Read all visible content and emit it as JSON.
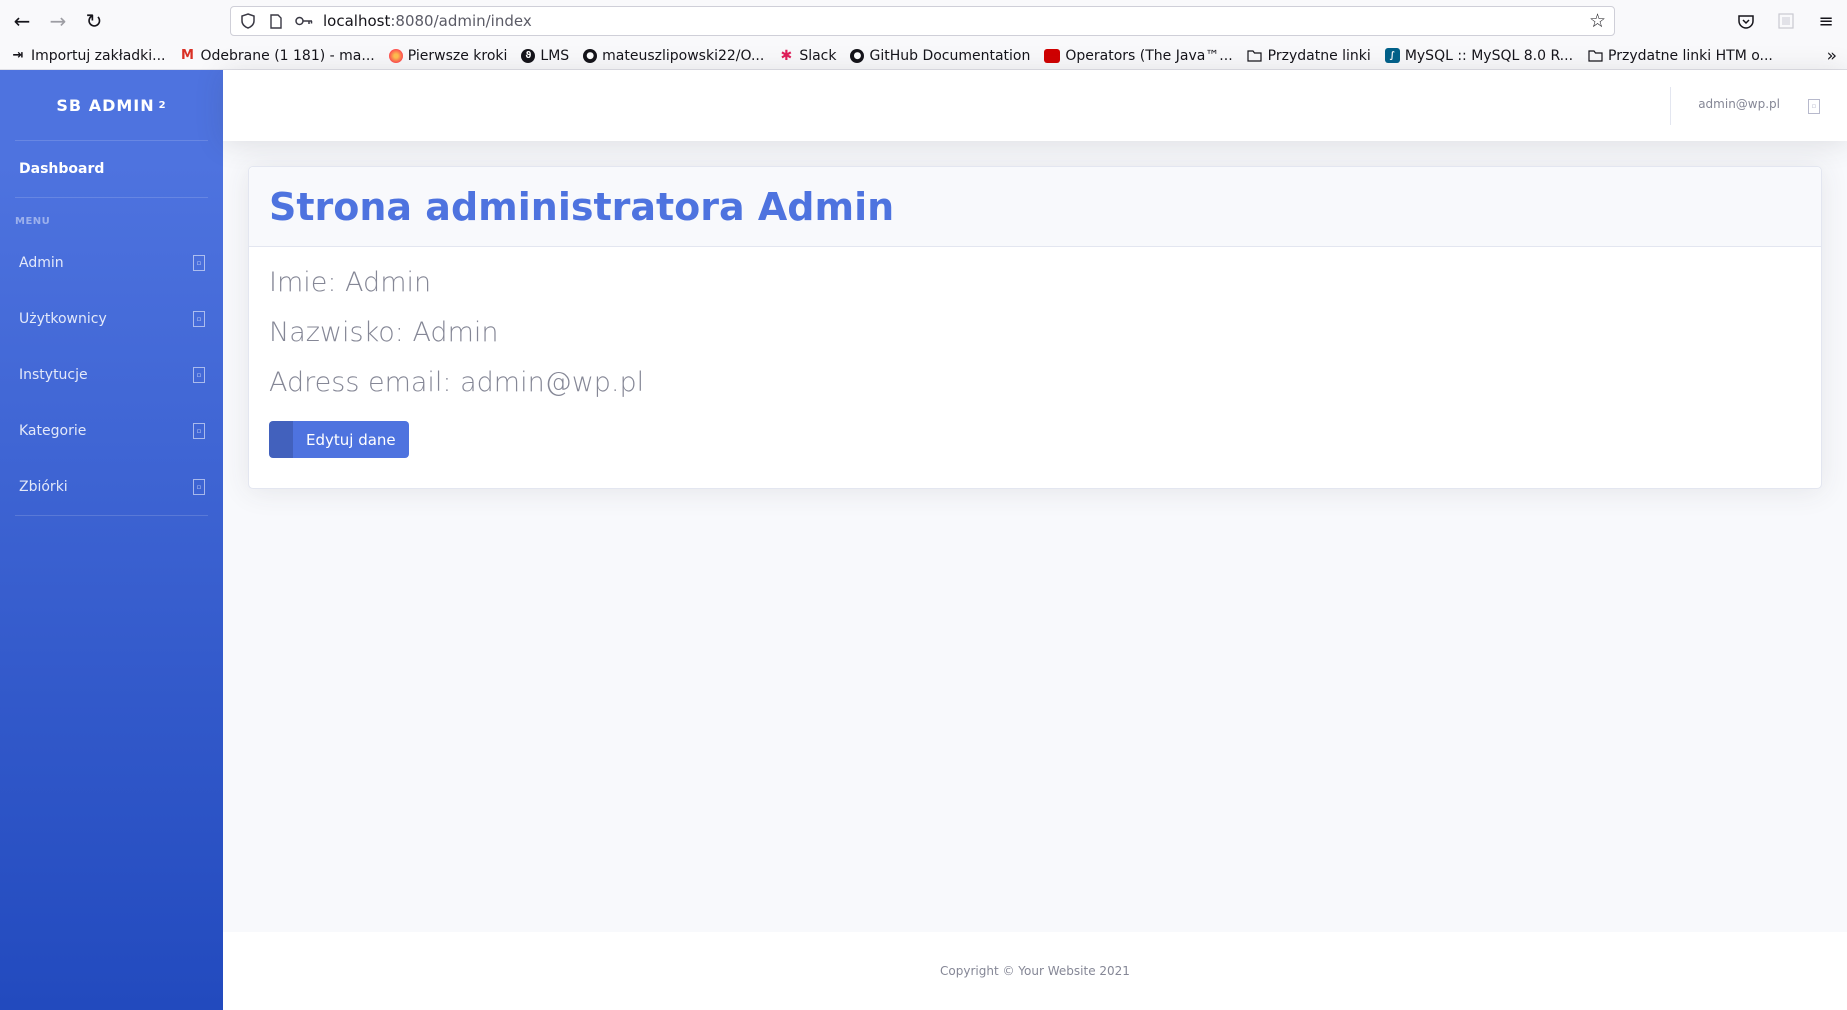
{
  "browser": {
    "url_host": "localhost",
    "url_rest": ":8080/admin/index",
    "bookmarks": [
      {
        "label": "Importuj zakładki...",
        "icon": "import-icon",
        "color": "#15141a"
      },
      {
        "label": "Odebrane (1 181) - ma...",
        "icon": "gmail-icon",
        "color": "#d93025"
      },
      {
        "label": "Pierwsze kroki",
        "icon": "firefox-icon",
        "color": "#ff7139"
      },
      {
        "label": "LMS",
        "icon": "lms-icon",
        "color": "#15141a"
      },
      {
        "label": "mateuszlipowski22/O...",
        "icon": "github-icon",
        "color": "#15141a"
      },
      {
        "label": "Slack",
        "icon": "slack-icon",
        "color": "#e01e5a"
      },
      {
        "label": "GitHub Documentation",
        "icon": "github-icon",
        "color": "#15141a"
      },
      {
        "label": "Operators (The Java™...",
        "icon": "oracle-icon",
        "color": "#d00000"
      },
      {
        "label": "Przydatne linki",
        "icon": "folder-icon",
        "color": "#15141a"
      },
      {
        "label": "MySQL :: MySQL 8.0 R...",
        "icon": "mysql-icon",
        "color": "#00618a"
      },
      {
        "label": "Przydatne linki HTM o...",
        "icon": "folder-icon",
        "color": "#15141a"
      }
    ]
  },
  "sidebar": {
    "brand": "SB ADMIN",
    "brand_sup": "2",
    "dashboard": "Dashboard",
    "heading": "MENU",
    "items": [
      {
        "label": "Admin"
      },
      {
        "label": "Użytkownicy"
      },
      {
        "label": "Instytucje"
      },
      {
        "label": "Kategorie"
      },
      {
        "label": "Zbiórki"
      }
    ]
  },
  "topbar": {
    "user_email": "admin@wp.pl"
  },
  "main": {
    "title": "Strona administratora Admin",
    "first_name_line": "Imie: Admin",
    "last_name_line": "Nazwisko: Admin",
    "email_line": "Adress email: admin@wp.pl",
    "edit_button": "Edytuj dane"
  },
  "footer": {
    "copyright": "Copyright © Your Website 2021"
  },
  "colors": {
    "primary": "#4e73df",
    "sidebar_gradient_end": "#224abe",
    "text_muted": "#858796"
  }
}
